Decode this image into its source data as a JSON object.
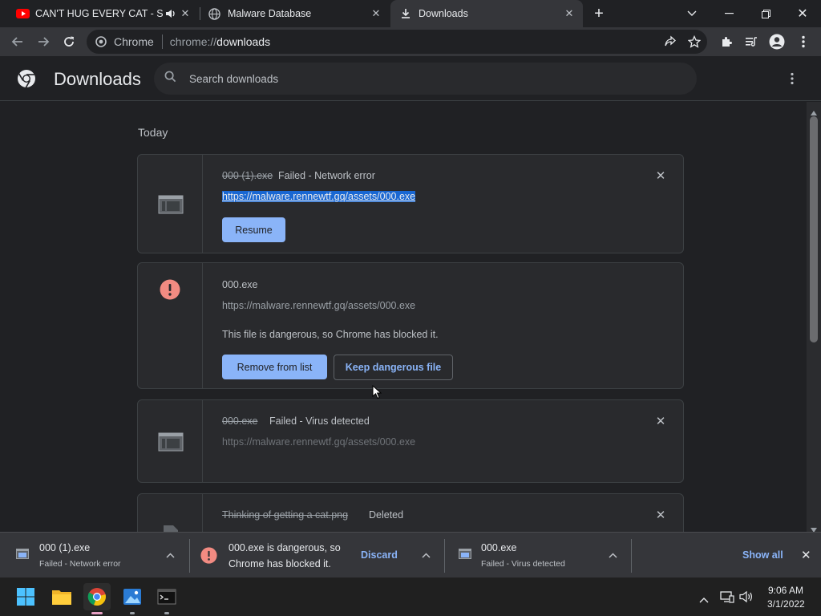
{
  "tabs": [
    {
      "title": "CAN'T HUG EVERY CAT - Son"
    },
    {
      "title": "Malware Database"
    },
    {
      "title": "Downloads"
    }
  ],
  "omnibox": {
    "chip": "Chrome",
    "url_prefix": "chrome://",
    "url_main": "downloads"
  },
  "page": {
    "title": "Downloads",
    "search_placeholder": "Search downloads"
  },
  "section": {
    "date": "Today"
  },
  "downloads": [
    {
      "filename": "000 (1).exe",
      "status": "Failed - Network error",
      "url": "https://malware.rennewtf.gq/assets/000.exe",
      "button": "Resume"
    },
    {
      "filename": "000.exe",
      "url": "https://malware.rennewtf.gq/assets/000.exe",
      "warning": "This file is dangerous, so Chrome has blocked it.",
      "button_remove": "Remove from list",
      "button_keep": "Keep dangerous file"
    },
    {
      "filename": "000.exe",
      "status": "Failed - Virus detected",
      "url": "https://malware.rennewtf.gq/assets/000.exe"
    },
    {
      "filename": "Thinking of getting a cat.png",
      "status": "Deleted"
    }
  ],
  "shelf": {
    "items": [
      {
        "name": "000 (1).exe",
        "status": "Failed - Network error"
      },
      {
        "line1": "000.exe is dangerous, so",
        "line2": "Chrome has blocked it.",
        "action": "Discard"
      },
      {
        "name": "000.exe",
        "status": "Failed - Virus detected"
      }
    ],
    "show_all": "Show all"
  },
  "taskbar": {
    "time": "9:06 AM",
    "date": "3/1/2022"
  },
  "colors": {
    "accent": "#8ab4f8",
    "danger": "#f28b82",
    "background": "#202124",
    "surface": "#292a2d"
  }
}
